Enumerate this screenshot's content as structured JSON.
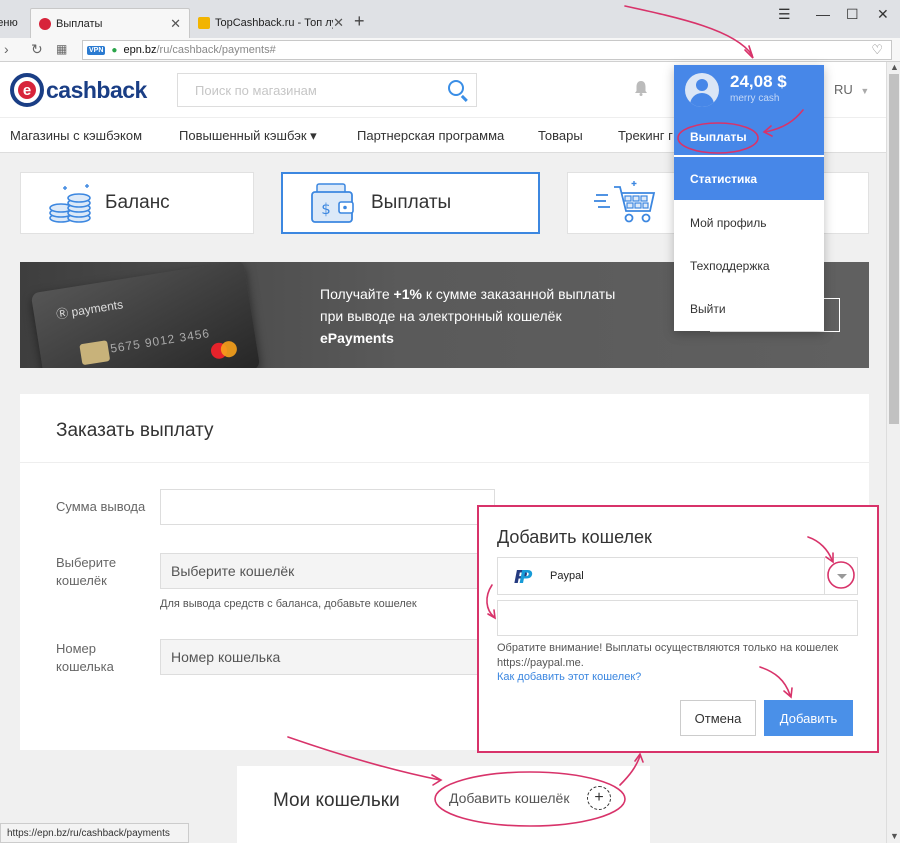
{
  "browser": {
    "menu_tab_label": "Меню",
    "active_tab_title": "Выплаты",
    "inactive_tab_title": "TopCashback.ru - Топ луч",
    "tab_close": "✕",
    "new_tab": "+",
    "url_badge": "VPN",
    "url_domain": "epn.bz",
    "url_path": "/ru/cashback/payments#",
    "status_url": "https://epn.bz/ru/cashback/payments"
  },
  "header": {
    "logo_letter": "e",
    "logo_text": "cashback",
    "search_placeholder": "Поиск по магазинам",
    "lang": "RU"
  },
  "nav": {
    "items": [
      "Магазины с кэшбэком",
      "Повышенный кэшбэк ▾",
      "Партнерская программа",
      "Товары",
      "Трекинг г"
    ]
  },
  "cards": {
    "balance": "Баланс",
    "payouts": "Выплаты"
  },
  "banner": {
    "line1_prefix": "Получайте ",
    "line1_bold": "+1%",
    "line1_suffix": " к сумме заказанной выплаты",
    "line2": "при выводе на электронный кошелёк",
    "line3": "ePayments",
    "card_brand": "payments",
    "card_number": "5675 9012 3456"
  },
  "order_form": {
    "title": "Заказать выплату",
    "amount_label": "Сумма вывода",
    "wallet_label_1": "Выберите",
    "wallet_label_2": "кошелёк",
    "wallet_placeholder": "Выберите кошелёк",
    "wallet_hint": "Для вывода средств с баланса, добавьте кошелек",
    "number_label_1": "Номер",
    "number_label_2": "кошелька",
    "number_placeholder": "Номер кошелька"
  },
  "wallets": {
    "title": "Мои кошельки",
    "add_label": "Добавить кошелёк",
    "add_icon": "+"
  },
  "user_menu": {
    "balance": "24,08 $",
    "username": "merry cash",
    "items": [
      "Выплаты",
      "Статистика",
      "Мой профиль",
      "Техподдержка",
      "Выйти"
    ]
  },
  "modal": {
    "title": "Добавить кошелек",
    "selected_wallet": "Paypal",
    "note": "Обратите внимание! Выплаты осуществляются только на кошелек https://paypal.me.",
    "help_link": "Как добавить этот кошелек?",
    "cancel": "Отмена",
    "submit": "Добавить"
  },
  "colors": {
    "accent_blue": "#4787e8",
    "annotation_magenta": "#d8336a",
    "brand_navy": "#1a3e85",
    "brand_red": "#d7243b"
  }
}
